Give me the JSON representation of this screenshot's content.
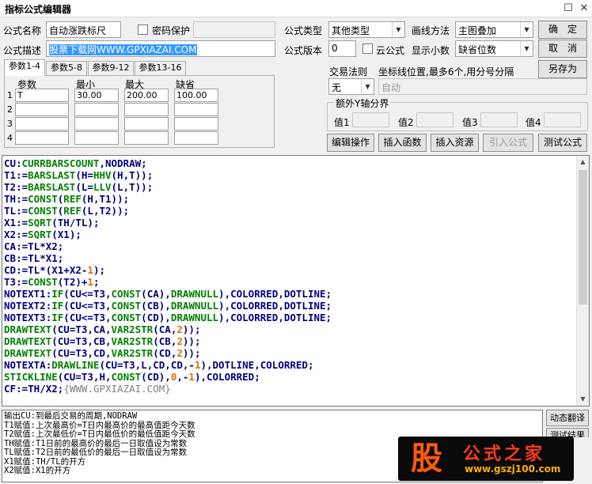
{
  "window": {
    "title": "指标公式编辑器",
    "restore_glyph": "☐",
    "close_glyph": "✕"
  },
  "form": {
    "name_label": "公式名称",
    "name_value": "自动涨跌标尺",
    "password_label": "密码保护",
    "desc_label": "公式描述",
    "desc_value": "股票下载网WWW.GPXIAZAI.COM",
    "type_label": "公式类型",
    "type_value": "其他类型",
    "draw_label": "画线方法",
    "draw_value": "主图叠加",
    "version_label": "公式版本",
    "version_value": "0",
    "cloud_label": "云公式",
    "decimal_label": "显示小数",
    "decimal_value": "缺省位数"
  },
  "buttons": {
    "ok": "确　定",
    "cancel": "取　消",
    "save_as": "另存为",
    "edit_ops": "编辑操作",
    "insert_func": "插入函数",
    "insert_res": "插入资源",
    "import_formula": "引入公式",
    "test_formula": "测试公式"
  },
  "tabs": [
    "参数1-4",
    "参数5-8",
    "参数9-12",
    "参数13-16"
  ],
  "params": {
    "headers": [
      "参数",
      "最小",
      "最大",
      "缺省"
    ],
    "rows": [
      {
        "num": "1",
        "name": "T",
        "min": "30.00",
        "max": "200.00",
        "def": "100.00"
      },
      {
        "num": "2",
        "name": "",
        "min": "",
        "max": "",
        "def": ""
      },
      {
        "num": "3",
        "name": "",
        "min": "",
        "max": "",
        "def": ""
      },
      {
        "num": "4",
        "name": "",
        "min": "",
        "max": "",
        "def": ""
      }
    ]
  },
  "trade": {
    "rule_label": "交易法则",
    "rule_value": "无",
    "coord_label": "坐标线位置,最多6个,用分号分隔",
    "coord_value": "自动",
    "extra_axis_label": "额外Y轴分界",
    "values": [
      "值1",
      "值2",
      "值3",
      "值4"
    ]
  },
  "code_lines": [
    "CU:CURRBARSCOUNT,NODRAW;",
    "T1:=BARSLAST(H=HHV(H,T));",
    "T2:=BARSLAST(L=LLV(L,T));",
    "TH:=CONST(REF(H,T1));",
    "TL:=CONST(REF(L,T2));",
    "X1:=SQRT(TH/TL);",
    "X2:=SQRT(X1);",
    "CA:=TL*X2;",
    "CB:=TL*X1;",
    "CD:=TL*(X1+X2-1);",
    "T3:=CONST(T2)+1;",
    "NOTEXT1:IF(CU<=T3,CONST(CA),DRAWNULL),COLORRED,DOTLINE;",
    "NOTEXT2:IF(CU<=T3,CONST(CB),DRAWNULL),COLORRED,DOTLINE;",
    "NOTEXT3:IF(CU<=T3,CONST(CD),DRAWNULL),COLORRED,DOTLINE;",
    "DRAWTEXT(CU=T3,CA,VAR2STR(CA,2));",
    "DRAWTEXT(CU=T3,CB,VAR2STR(CB,2));",
    "DRAWTEXT(CU=T3,CD,VAR2STR(CD,2));",
    "NOTEXTA:DRAWLINE(CU=T3,L,CD,CD,-1),DOTLINE,COLORRED;",
    "STICKLINE(CU=T3,H,CONST(CD),0,-1),COLORRED;",
    "CF:=TH/X2;{WWW.GPXIAZAI.COM}"
  ],
  "help_lines": [
    "输出CU:到最后交易的周期,NODRAW",
    "T1赋值:上次最高价=T日内最高价的最高值距今天数",
    "T2赋值:上次最低价=T日内最低价的最低值距今天数",
    "TH赋值:T1日前的最高价的最后一日取值设为常数",
    "TL赋值:T2日前的最低价的最后一日取值设为常数",
    "X1赋值:TH/TL的开方",
    "X2赋值:X1的开方"
  ],
  "side_buttons": {
    "dynamic_translate": "动态翻译",
    "test_result": "测试结果"
  },
  "logo": {
    "char": "股",
    "name": "公式之家",
    "url": "www.gszj100.com"
  },
  "colors": {
    "keyword": "#000080",
    "function": "#008000",
    "number": "#e07000",
    "comment": "#808080"
  }
}
